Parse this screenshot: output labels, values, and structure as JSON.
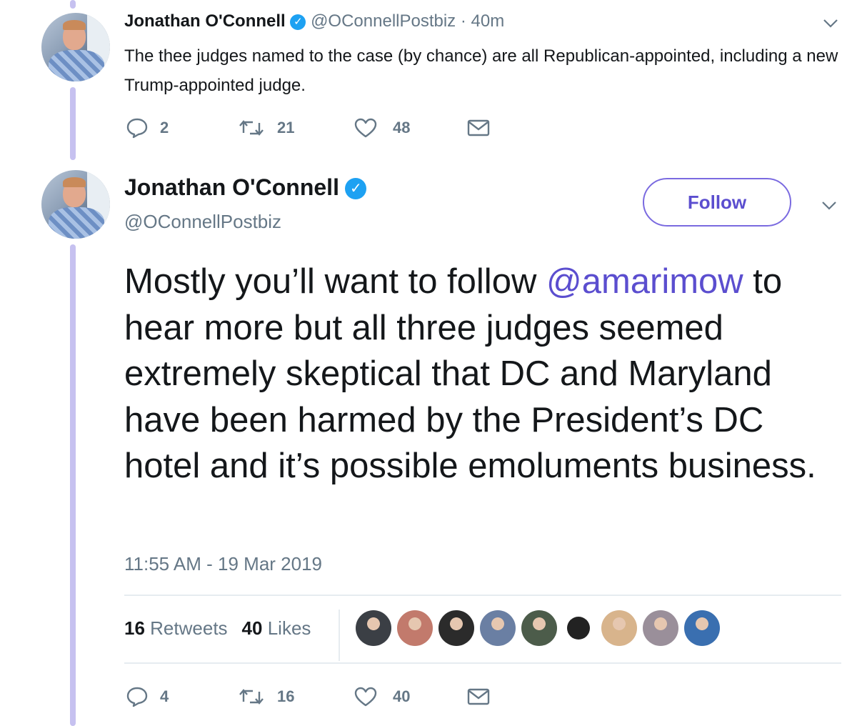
{
  "tweet1": {
    "author_name": "Jonathan O'Connell",
    "author_handle": "@OConnellPostbiz",
    "time_ago": "40m",
    "separator": "·",
    "text": "The thee judges named to the case (by chance) are all Republican-appointed, including a new Trump-appointed judge.",
    "replies": "2",
    "retweets": "21",
    "likes": "48"
  },
  "tweet2": {
    "author_name": "Jonathan O'Connell",
    "author_handle": "@OConnellPostbiz",
    "follow_label": "Follow",
    "text_before_mention": "Mostly you’ll want to follow ",
    "mention": "@amarimow",
    "text_after_mention": " to hear more but all three judges seemed extremely skeptical that DC and Maryland have been harmed by the President’s DC hotel and it’s possible emoluments business.",
    "timestamp": "11:55 AM - 19 Mar 2019",
    "retweet_count": "16",
    "retweet_label": "Retweets",
    "like_count": "40",
    "like_label": "Likes",
    "replies": "4",
    "retweets": "16",
    "likes": "40"
  },
  "likers": [
    {
      "name": "liker-avatar-1",
      "color": "#3b3f45"
    },
    {
      "name": "liker-avatar-2",
      "color": "#c27a6c"
    },
    {
      "name": "liker-avatar-3",
      "color": "#2b2b2b"
    },
    {
      "name": "liker-avatar-4",
      "color": "#6a7fa3"
    },
    {
      "name": "liker-avatar-5",
      "color": "#4c5c4a"
    },
    {
      "name": "liker-avatar-6",
      "color": "#222222"
    },
    {
      "name": "liker-avatar-7",
      "color": "#d8b48c"
    },
    {
      "name": "liker-avatar-8",
      "color": "#9a8f9a"
    },
    {
      "name": "liker-avatar-9",
      "color": "#3a6fb0"
    }
  ],
  "colors": {
    "accent": "#5b4ecf",
    "thread_line": "#c6c1f0",
    "verified": "#1da1f2",
    "muted": "#657786"
  }
}
